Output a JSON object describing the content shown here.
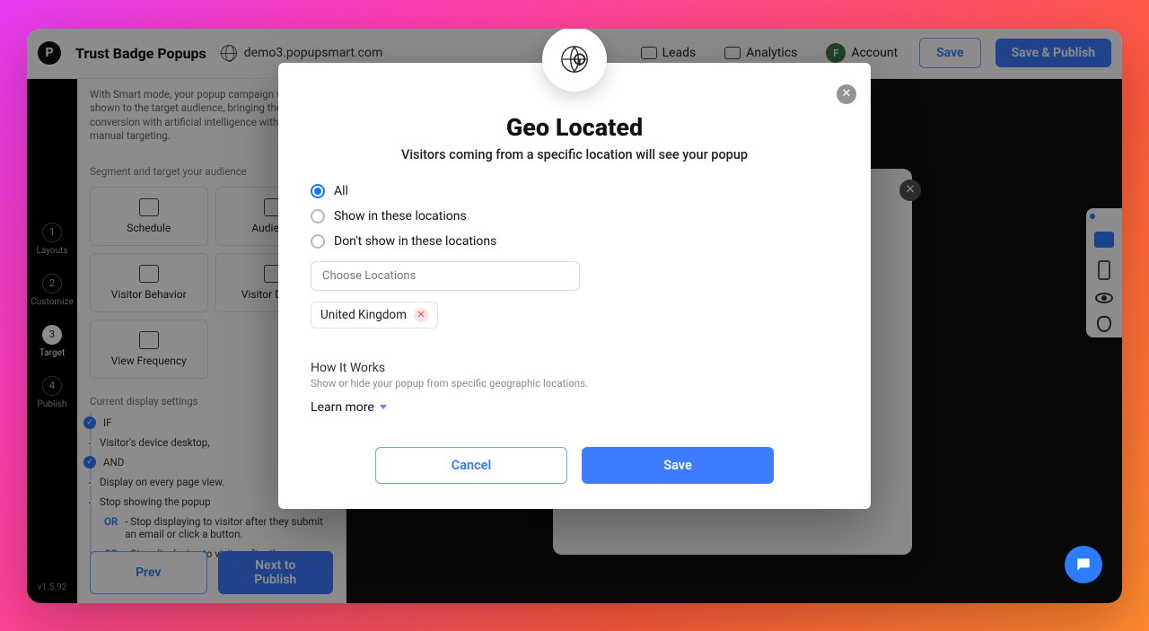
{
  "topbar": {
    "logo_letter": "P",
    "title": "Trust Badge Popups",
    "domain": "demo3.popupsmart.com",
    "nav": {
      "leads": "Leads",
      "analytics": "Analytics",
      "account": "Account",
      "account_initial": "F"
    },
    "save": "Save",
    "publish": "Save & Publish"
  },
  "rail": {
    "steps": [
      {
        "num": "1",
        "label": "Layouts"
      },
      {
        "num": "2",
        "label": "Customize"
      },
      {
        "num": "3",
        "label": "Target"
      },
      {
        "num": "4",
        "label": "Publish"
      }
    ],
    "version": "v1.5.92"
  },
  "panel": {
    "smart_desc": "With Smart mode, your popup campaign will be shown to the target audience, bringing the most conversion with artificial intelligence without any manual targeting.",
    "segment_label": "Segment and target your audience",
    "tiles": [
      "Schedule",
      "Audience",
      "Visitor Behavior",
      "Visitor Device",
      "View Frequency"
    ],
    "disp_label": "Current display settings",
    "rules": {
      "if": "IF",
      "device": "Visitor's device desktop,",
      "and": "AND",
      "display": "Display on every page view.",
      "stop_header": "Stop showing the popup",
      "or1": "OR",
      "stop1": "- Stop displaying to visitor after they submit an email or click a button.",
      "or2": "OR",
      "stop2": "- Stop displaying to visitor after the"
    },
    "prev": "Prev",
    "next": "Next to Publish"
  },
  "modal": {
    "title": "Geo Located",
    "subtitle": "Visitors coming from a specific location will see your popup",
    "options": {
      "all": "All",
      "show": "Show in these locations",
      "hide": "Don't show in these locations"
    },
    "input_placeholder": "Choose Locations",
    "chips": [
      "United Kingdom"
    ],
    "hiw_title": "How It Works",
    "hiw_desc": "Show or hide your popup from specific geographic locations.",
    "learn_more": "Learn more",
    "cancel": "Cancel",
    "save": "Save"
  }
}
